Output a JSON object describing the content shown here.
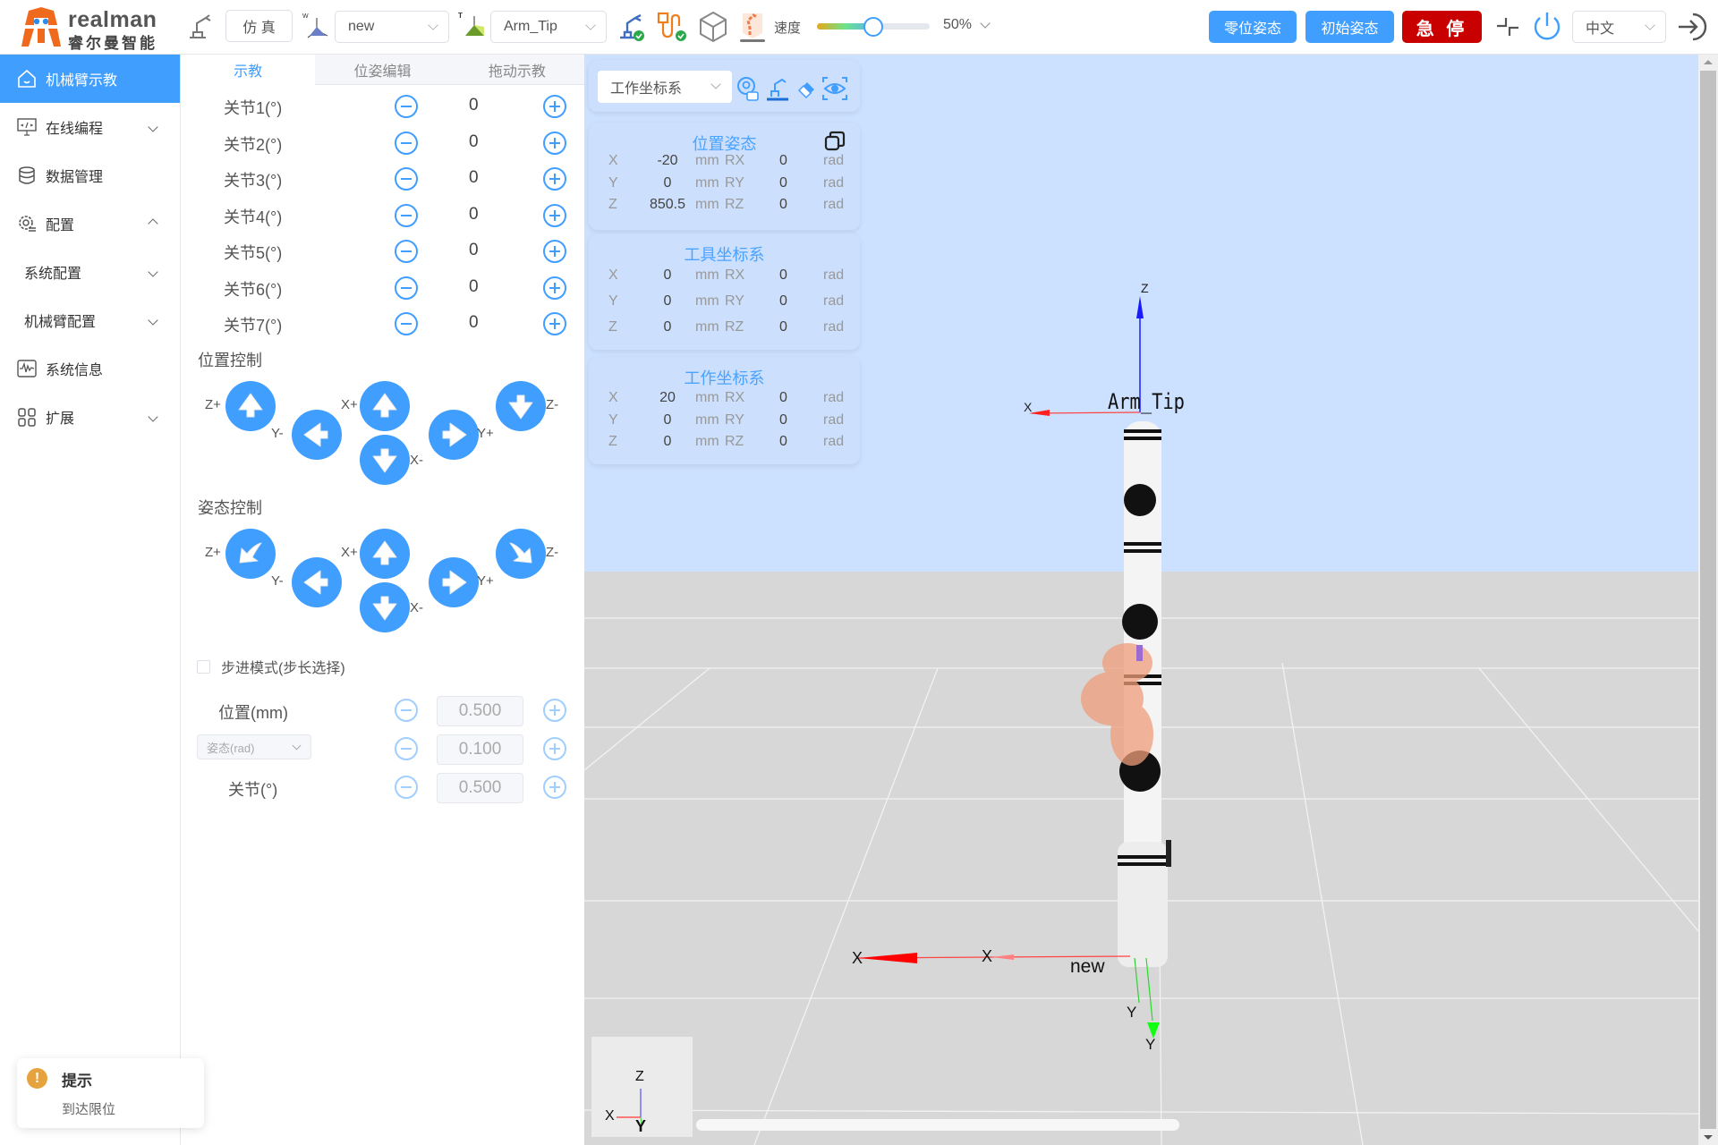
{
  "header": {
    "brand": "realman",
    "brand_cn": "睿尔曼智能",
    "mode_button": "仿 真",
    "work_frame_select": "new",
    "tool_frame_select": "Arm_Tip",
    "speed_label": "速度",
    "speed_percent": 50,
    "speed_value_text": "50%",
    "zero_pose_button": "零位姿态",
    "initial_pose_button": "初始姿态",
    "estop_button": "急 停",
    "language_select": "中文",
    "colors": {
      "primary": "#409eff",
      "danger": "#c80000"
    }
  },
  "sidebar": {
    "items": [
      {
        "label": "机械臂示教",
        "icon": "home-icon",
        "active": true
      },
      {
        "label": "在线编程",
        "icon": "code-monitor-icon",
        "expand": "down"
      },
      {
        "label": "数据管理",
        "icon": "database-icon"
      },
      {
        "label": "配置",
        "icon": "settings-icon",
        "expand": "up"
      },
      {
        "label": "系统配置",
        "sub": true,
        "expand": "down"
      },
      {
        "label": "机械臂配置",
        "sub": true,
        "expand": "down"
      },
      {
        "label": "系统信息",
        "icon": "pulse-icon"
      },
      {
        "label": "扩展",
        "icon": "apps-icon",
        "expand": "down"
      }
    ]
  },
  "panel": {
    "tabs": [
      "示教",
      "位姿编辑",
      "拖动示教"
    ],
    "active_tab": 0,
    "joints": [
      {
        "label": "关节1(°)",
        "value": "0"
      },
      {
        "label": "关节2(°)",
        "value": "0"
      },
      {
        "label": "关节3(°)",
        "value": "0"
      },
      {
        "label": "关节4(°)",
        "value": "0"
      },
      {
        "label": "关节5(°)",
        "value": "0"
      },
      {
        "label": "关节6(°)",
        "value": "0"
      },
      {
        "label": "关节7(°)",
        "value": "0"
      }
    ],
    "position_control": {
      "title": "位置控制",
      "labels": {
        "zp": "Z+",
        "ym": "Y-",
        "xp": "X+",
        "xm": "X-",
        "yp": "Y+",
        "zm": "Z-"
      }
    },
    "orientation_control": {
      "title": "姿态控制",
      "labels": {
        "zp": "Z+",
        "ym": "Y-",
        "xp": "X+",
        "xm": "X-",
        "yp": "Y+",
        "zm": "Z-"
      }
    },
    "step_mode": {
      "label": "步进模式(步长选择)",
      "checked": false
    },
    "steps": [
      {
        "label": "位置(mm)",
        "value": "0.500"
      },
      {
        "label": "姿态(rad)",
        "value": "0.100",
        "is_select": true
      },
      {
        "label": "关节(°)",
        "value": "0.500"
      }
    ]
  },
  "viewport": {
    "frame_select": "工作坐标系",
    "cards": [
      {
        "title": "位置姿态",
        "rows": [
          {
            "axis": "X",
            "val": "-20",
            "unit": "mm",
            "raxis": "RX",
            "rval": "0",
            "runit": "rad"
          },
          {
            "axis": "Y",
            "val": "0",
            "unit": "mm",
            "raxis": "RY",
            "rval": "0",
            "runit": "rad"
          },
          {
            "axis": "Z",
            "val": "850.5",
            "unit": "mm",
            "raxis": "RZ",
            "rval": "0",
            "runit": "rad"
          }
        ]
      },
      {
        "title": "工具坐标系",
        "rows": [
          {
            "axis": "X",
            "val": "0",
            "unit": "mm",
            "raxis": "RX",
            "rval": "0",
            "runit": "rad"
          },
          {
            "axis": "Y",
            "val": "0",
            "unit": "mm",
            "raxis": "RY",
            "rval": "0",
            "runit": "rad"
          },
          {
            "axis": "Z",
            "val": "0",
            "unit": "mm",
            "raxis": "RZ",
            "rval": "0",
            "runit": "rad"
          }
        ]
      },
      {
        "title": "工作坐标系",
        "rows": [
          {
            "axis": "X",
            "val": "20",
            "unit": "mm",
            "raxis": "RX",
            "rval": "0",
            "runit": "rad"
          },
          {
            "axis": "Y",
            "val": "0",
            "unit": "mm",
            "raxis": "RY",
            "rval": "0",
            "runit": "rad"
          },
          {
            "axis": "Z",
            "val": "0",
            "unit": "mm",
            "raxis": "RZ",
            "rval": "0",
            "runit": "rad"
          }
        ]
      }
    ],
    "scene_labels": {
      "tip_frame": "Arm_Tip",
      "base_frame": "new",
      "z": "Z",
      "x": "X",
      "y": "Y"
    }
  },
  "toast": {
    "title": "提示",
    "message": "到达限位",
    "icon": "warning-icon"
  }
}
